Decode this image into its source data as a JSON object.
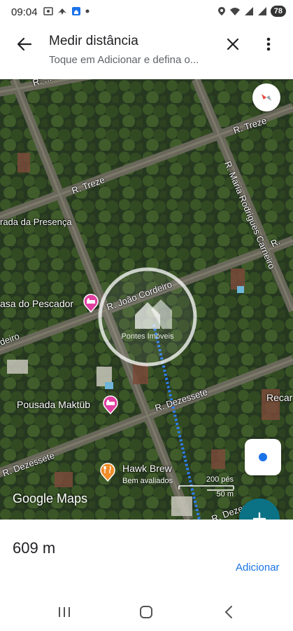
{
  "status_bar": {
    "time": "09:04",
    "battery": "78",
    "icons": [
      "screenshot-icon",
      "bird-icon",
      "home-app-icon",
      "dot-icon",
      "location-icon",
      "wifi-icon",
      "signal-icon",
      "signal-icon"
    ]
  },
  "header": {
    "title": "Medir distância",
    "subtitle": "Toque em Adicionar e defina o..."
  },
  "map": {
    "streets": [
      "R. ...",
      "R. Treze",
      "R. Treze",
      "R. Maria Rodrigues Carneiro",
      "rada da Presença",
      "R. João Cordeiro",
      "deiro",
      "R. Dezessete",
      "R. Dezessete",
      "R. Dezenove",
      "R."
    ],
    "pois": [
      {
        "name": "asa do Pescador",
        "icon": "hotel-icon",
        "color": "#e040a0"
      },
      {
        "name": "Pousada Maktüb",
        "icon": "hotel-icon",
        "color": "#e040a0"
      },
      {
        "name": "Hawk Brew",
        "subtitle": "Bem avaliados",
        "icon": "restaurant-icon",
        "color": "#f08c2a"
      }
    ],
    "edge_label": "Recar",
    "watermark": "Pontes Imóveis",
    "scale": {
      "top": "200 pés",
      "bottom": "50 m"
    },
    "logo": "Google Maps",
    "measure_line_color": "#2f7ff0"
  },
  "bottom": {
    "distance": "609 m",
    "add_label": "Adicionar"
  },
  "colors": {
    "accent": "#1a73e8",
    "fab": "#0b7285"
  }
}
